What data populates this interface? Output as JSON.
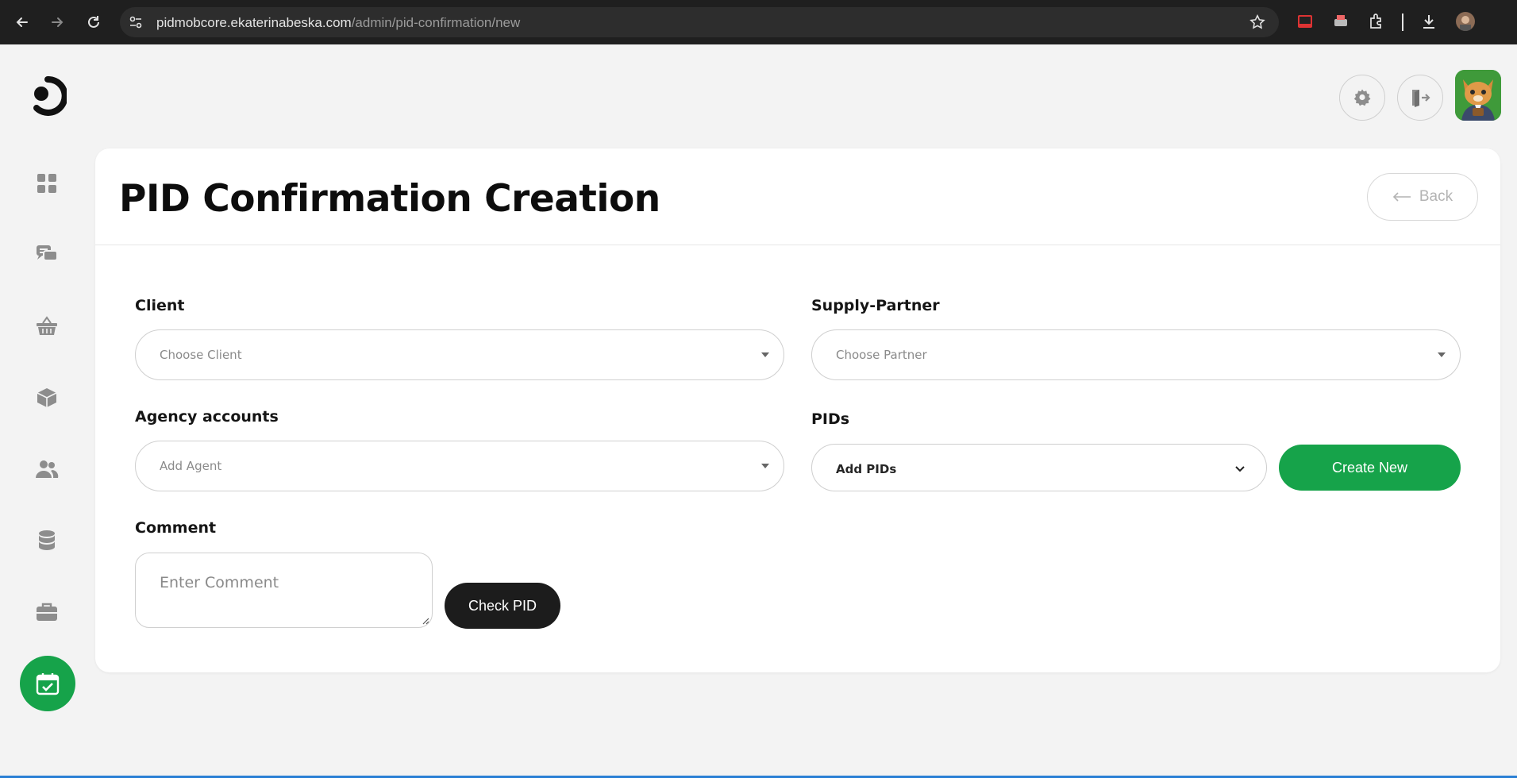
{
  "browser": {
    "url_host": "pidmobcore.ekaterinabeska.com",
    "url_path": "/admin/pid-confirmation/new"
  },
  "header": {
    "settings_icon": "gear-icon",
    "logout_icon": "logout-door-icon"
  },
  "sidebar": {
    "items": [
      {
        "icon": "dashboard-grid-icon"
      },
      {
        "icon": "chat-bubbles-icon"
      },
      {
        "icon": "basket-icon"
      },
      {
        "icon": "box-icon"
      },
      {
        "icon": "users-icon"
      },
      {
        "icon": "database-icon"
      },
      {
        "icon": "briefcase-icon"
      },
      {
        "icon": "calendar-check-icon",
        "active": true
      }
    ],
    "active_color": "#16a34a"
  },
  "page": {
    "title": "PID Confirmation Creation",
    "back_label": "Back"
  },
  "form": {
    "client_label": "Client",
    "client_placeholder": "Choose Client",
    "partner_label": "Supply-Partner",
    "partner_placeholder": "Choose Partner",
    "agency_label": "Agency accounts",
    "agency_placeholder": "Add Agent",
    "pids_label": "PIDs",
    "pids_placeholder": "Add PIDs",
    "create_new_label": "Create New",
    "comment_label": "Comment",
    "comment_placeholder": "Enter Comment",
    "check_pid_label": "Check PID"
  },
  "colors": {
    "accent_green": "#16a34a",
    "dark_button": "#1c1c1c"
  }
}
